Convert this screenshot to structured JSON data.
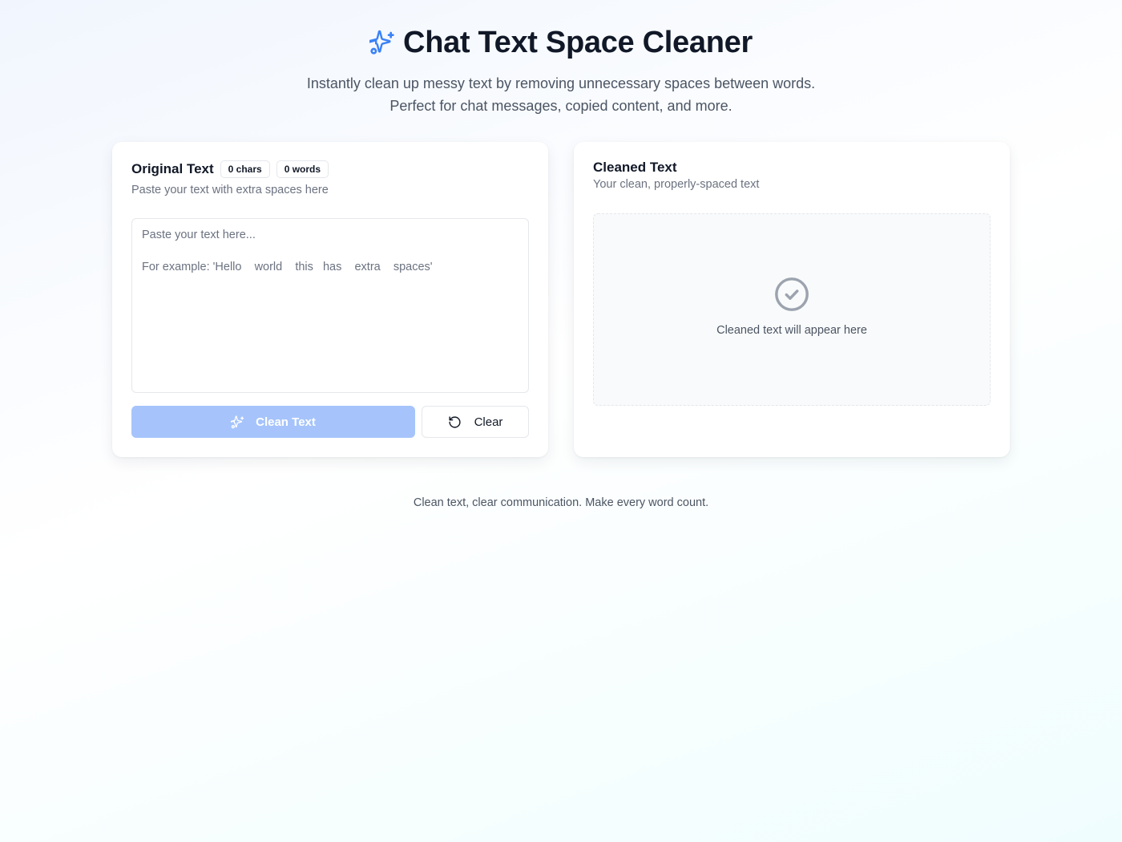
{
  "header": {
    "title": "Chat Text Space Cleaner",
    "subtitle": "Instantly clean up messy text by removing unnecessary spaces between words. Perfect for chat messages, copied content, and more.",
    "icon": "sparkles-icon"
  },
  "input_panel": {
    "title": "Original Text",
    "chars_badge": "0 chars",
    "words_badge": "0 words",
    "subtitle": "Paste your text with extra spaces here",
    "textarea_value": "",
    "textarea_placeholder": "Paste your text here...\n\nFor example: 'Hello    world    this   has    extra    spaces'",
    "clean_button_label": "Clean Text",
    "clear_button_label": "Clear"
  },
  "output_panel": {
    "title": "Cleaned Text",
    "subtitle": "Your clean, properly-spaced text",
    "placeholder": "Cleaned text will appear here",
    "icon": "check-circle-icon"
  },
  "footer": {
    "text": "Clean text, clear communication. Make every word count."
  },
  "colors": {
    "accent": "#3b82f6",
    "accent_disabled": "#a6c4fb",
    "heading": "#111827",
    "muted": "#6b7280"
  }
}
